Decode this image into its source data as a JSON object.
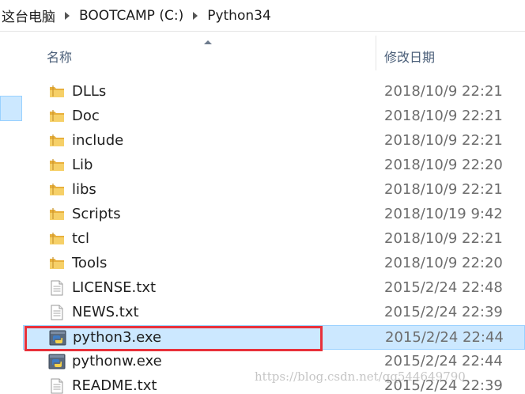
{
  "breadcrumb": {
    "items": [
      "这台电脑",
      "BOOTCAMP (C:)",
      "Python34"
    ]
  },
  "columns": {
    "name": "名称",
    "date_modified": "修改日期"
  },
  "files": [
    {
      "name": "DLLs",
      "date": "2018/10/9 22:21",
      "icon": "folder-icon",
      "type": "folder"
    },
    {
      "name": "Doc",
      "date": "2018/10/9 22:21",
      "icon": "folder-icon",
      "type": "folder"
    },
    {
      "name": "include",
      "date": "2018/10/9 22:21",
      "icon": "folder-icon",
      "type": "folder"
    },
    {
      "name": "Lib",
      "date": "2018/10/9 22:20",
      "icon": "folder-icon",
      "type": "folder"
    },
    {
      "name": "libs",
      "date": "2018/10/9 22:21",
      "icon": "folder-icon",
      "type": "folder"
    },
    {
      "name": "Scripts",
      "date": "2018/10/19 9:42",
      "icon": "folder-icon",
      "type": "folder"
    },
    {
      "name": "tcl",
      "date": "2018/10/9 22:21",
      "icon": "folder-icon",
      "type": "folder"
    },
    {
      "name": "Tools",
      "date": "2018/10/9 22:20",
      "icon": "folder-icon",
      "type": "folder"
    },
    {
      "name": "LICENSE.txt",
      "date": "2015/2/24 22:48",
      "icon": "text-file-icon",
      "type": "text"
    },
    {
      "name": "NEWS.txt",
      "date": "2015/2/24 22:39",
      "icon": "text-file-icon",
      "type": "text"
    },
    {
      "name": "python3.exe",
      "date": "2015/2/24 22:44",
      "icon": "python-icon",
      "type": "exe",
      "selected": true
    },
    {
      "name": "pythonw.exe",
      "date": "2015/2/24 22:44",
      "icon": "python-icon",
      "type": "exe"
    },
    {
      "name": "README.txt",
      "date": "2015/2/24 22:39",
      "icon": "text-file-icon",
      "type": "text"
    }
  ],
  "watermark": "https://blog.csdn.net/qq544649790",
  "colors": {
    "selection_bg": "#cce8ff",
    "selection_border": "#99d1ff",
    "highlight_box": "#e8303a",
    "folder": "#f2c24e"
  }
}
